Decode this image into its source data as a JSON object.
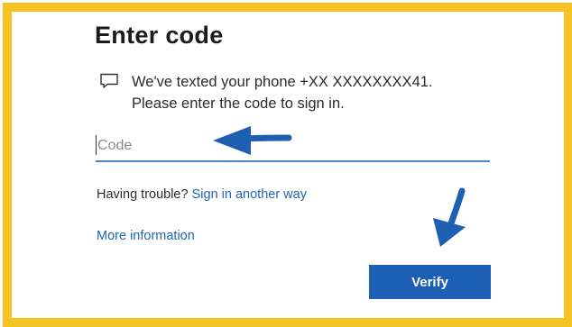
{
  "colors": {
    "frame_border": "#f6c324",
    "link": "#2465b0",
    "button_bg": "#1c5fb4",
    "input_underline": "#4a86c5",
    "annotation_arrow": "#1f5fb2"
  },
  "page": {
    "title": "Enter code",
    "message_line1": "We've texted your phone +XX XXXXXXXX41.",
    "message_line2": "Please enter the code to sign in.",
    "message_icon": "chat-bubble-icon"
  },
  "code_input": {
    "placeholder": "Code",
    "value": ""
  },
  "help": {
    "trouble_text": "Having trouble?",
    "sign_in_another_way": "Sign in another way",
    "more_information": "More information"
  },
  "actions": {
    "verify_label": "Verify"
  },
  "annotations": {
    "arrow_icons": [
      "left-arrow-icon",
      "down-arrow-icon"
    ]
  }
}
